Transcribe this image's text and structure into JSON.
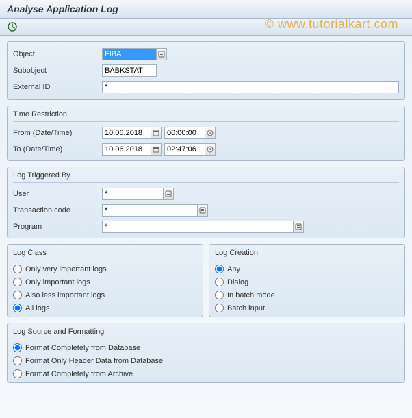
{
  "title": "Analyse Application Log",
  "watermark": "© www.tutorialkart.com",
  "fields": {
    "object": {
      "label": "Object",
      "value": "FIBA"
    },
    "subobject": {
      "label": "Subobject",
      "value": "BABKSTAT"
    },
    "external_id": {
      "label": "External ID",
      "value": "*"
    }
  },
  "time_restriction": {
    "title": "Time Restriction",
    "from": {
      "label": "From (Date/Time)",
      "date": "10.06.2018",
      "time": "00:00:00"
    },
    "to": {
      "label": "To (Date/Time)",
      "date": "10.06.2018",
      "time": "02:47:06"
    }
  },
  "log_triggered_by": {
    "title": "Log Triggered By",
    "user": {
      "label": "User",
      "value": "*"
    },
    "transaction_code": {
      "label": "Transaction code",
      "value": "*"
    },
    "program": {
      "label": "Program",
      "value": "*"
    }
  },
  "log_class": {
    "title": "Log Class",
    "options": [
      "Only very important logs",
      "Only important logs",
      "Also less important logs",
      "All logs"
    ],
    "selected": 3
  },
  "log_creation": {
    "title": "Log Creation",
    "options": [
      "Any",
      "Dialog",
      "In batch mode",
      "Batch input"
    ],
    "selected": 0
  },
  "log_source": {
    "title": "Log Source and Formatting",
    "options": [
      "Format Completely from Database",
      "Format Only Header Data from Database",
      "Format Completely from Archive"
    ],
    "selected": 0
  }
}
